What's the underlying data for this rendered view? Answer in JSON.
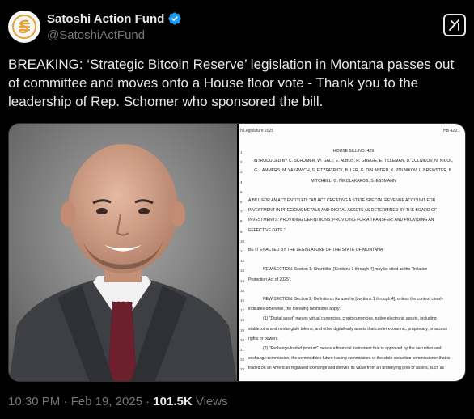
{
  "author": {
    "display_name": "Satoshi Action Fund",
    "handle": "@SatoshiActFund",
    "verified": true,
    "avatar_icon": "satoshi-action-fund-logo-icon"
  },
  "grok": {
    "icon": "grok-icon"
  },
  "tweet": {
    "text": "BREAKING: ‘Strategic Bitcoin Reserve’ legislation in Montana passes out of committee and moves onto a House floor vote - Thank you to the leadership of Rep. Schomer who sponsored the bill."
  },
  "media": {
    "photo_description": "portrait",
    "document": {
      "header_left": "h Legislature 2025",
      "header_right": "HB 429.1",
      "line_numbers": [
        "1",
        "2",
        "3",
        "4",
        "5",
        "6",
        "7",
        "8",
        "9",
        "10",
        "11",
        "12",
        "13",
        "14",
        "15",
        "16",
        "17",
        "18",
        "19",
        "20",
        "21",
        "22",
        "23"
      ],
      "lines": [
        {
          "text": "HOUSE BILL NO. 429",
          "style": "center"
        },
        {
          "text": "INTRODUCED BY C. SCHOMER, W. GALT, E. ALBUS, R. GREGG, E. TILLEMAN, D. ZOLNIKOV, N. NICOL,",
          "style": "center"
        },
        {
          "text": "G. LAMMERS, M. YAKAWICH, S. FITZPATRICK, B. LER, G. OBLANDER, K. ZOLNIKOV, L. BREWSTER, B.",
          "style": "center"
        },
        {
          "text": "MITCHELL, G. NIKOLAKAKOS, S. ESSMANN",
          "style": "center"
        },
        {
          "text": "",
          "style": ""
        },
        {
          "text": "A BILL FOR AN ACT ENTITLED: \"AN ACT CREATING A STATE SPECIAL REVENUE ACCOUNT FOR",
          "style": ""
        },
        {
          "text": "INVESTMENT IN PRECIOUS METALS AND DIGITAL ASSETS AS DETERMINED BY THE BOARD OF",
          "style": ""
        },
        {
          "text": "INVESTMENTS; PROVIDING DEFINITIONS; PROVIDING FOR A TRANSFER; AND PROVIDING AN",
          "style": ""
        },
        {
          "text": "EFFECTIVE DATE.\"",
          "style": ""
        },
        {
          "text": "",
          "style": ""
        },
        {
          "text": "BE IT ENACTED BY THE LEGISLATURE OF THE STATE OF MONTANA:",
          "style": ""
        },
        {
          "text": "",
          "style": ""
        },
        {
          "text": "NEW SECTION.  Section 1.  Short title. [Sections 1 through 4] may be cited as the \"Inflation",
          "style": "indent"
        },
        {
          "text": "Protection Act of 2025\".",
          "style": ""
        },
        {
          "text": "",
          "style": ""
        },
        {
          "text": "NEW SECTION.  Section 2.  Definitions. As used in [sections 1 through 4], unless the context clearly",
          "style": "indent"
        },
        {
          "text": "indicates otherwise, the following definitions apply:",
          "style": ""
        },
        {
          "text": "(1)      \"Digital asset\" means virtual currencies, cryptocurrencies, native electronic assets, including",
          "style": "indent"
        },
        {
          "text": "stablecoins and nonfungible tokens, and other digital-only assets that confer economic, proprietary, or access",
          "style": ""
        },
        {
          "text": "rights or powers.",
          "style": ""
        },
        {
          "text": "(2)      \"Exchange-traded product\" means a financial instrument that is approved by the securities and",
          "style": "indent"
        },
        {
          "text": "exchange commission, the commodities future trading commission, or the state securities commissioner that is",
          "style": ""
        },
        {
          "text": "traded on an American regulated exchange and derives its value from an underlying pool of assets, such as",
          "style": ""
        }
      ]
    }
  },
  "meta": {
    "time": "10:30 PM",
    "sep1": " · ",
    "date": "Feb 19, 2025",
    "sep2": " · ",
    "views_count": "101.5K",
    "views_label": " Views"
  }
}
